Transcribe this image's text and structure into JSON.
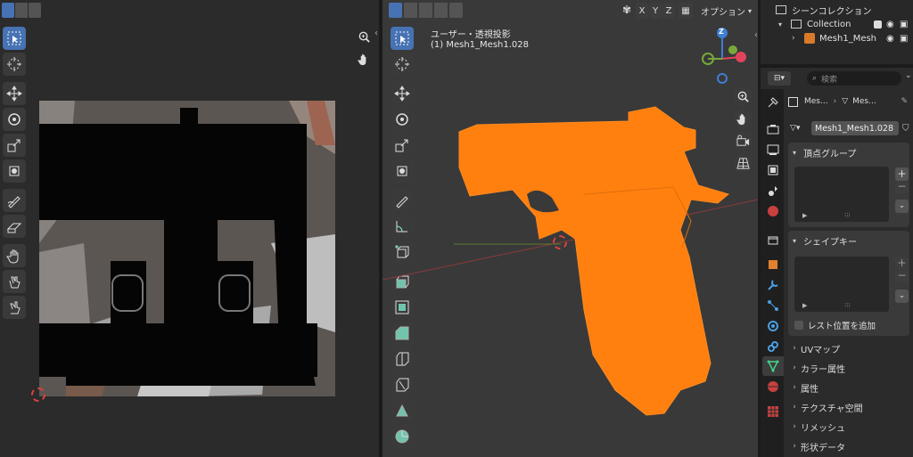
{
  "left_editor": {
    "name": "uv-editor",
    "tools": [
      "select-box-icon",
      "cursor-icon",
      "move-icon",
      "rotate-icon",
      "scale-icon",
      "transform-icon",
      "annotate-icon",
      "rip-icon",
      "grab-icon",
      "relax-icon",
      "pinch-icon"
    ]
  },
  "viewport": {
    "header_buttons": [
      "X",
      "Y",
      "Z"
    ],
    "options_label": "オプション",
    "view_mode_label": "ユーザー・透視投影",
    "object_label": "(1) Mesh1_Mesh1.028",
    "gizmo": {
      "z": "Z",
      "x_color": "#e0445c",
      "y_color": "#77a83a",
      "z_color": "#3e7ed6"
    },
    "mesh_color": "#ff7f0f"
  },
  "outliner": {
    "title": "シーンコレクション",
    "collection": "Collection",
    "object": "Mesh1_Mesh"
  },
  "properties": {
    "search_placeholder": "検索",
    "breadcrumb_object": "Mes...",
    "breadcrumb_data": "Mes...",
    "data_name": "Mesh1_Mesh1.028",
    "vertex_groups": "頂点グループ",
    "shape_keys": "シェイプキー",
    "relative_label": "レスト位置を追加",
    "sections": [
      "UVマップ",
      "カラー属性",
      "属性",
      "テクスチャ空間",
      "リメッシュ",
      "形状データ"
    ]
  }
}
